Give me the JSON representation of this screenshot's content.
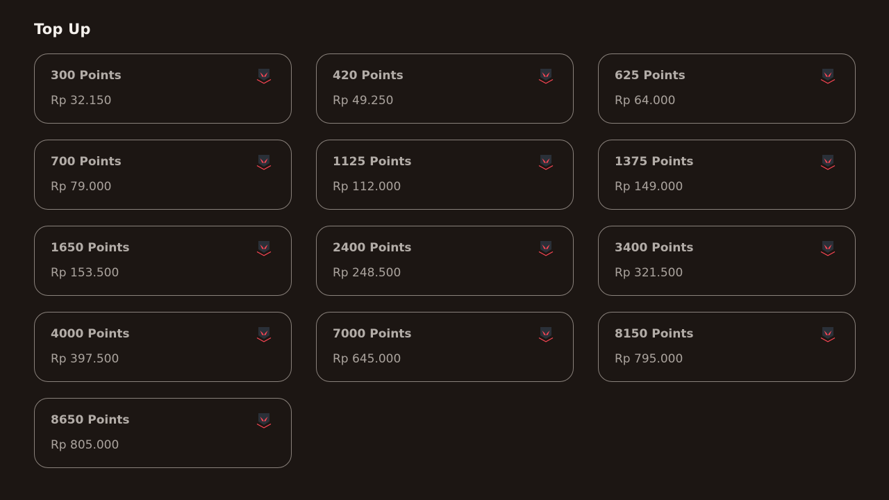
{
  "header": {
    "title": "Top Up"
  },
  "colors": {
    "background": "#1c1613",
    "card_border": "#8a827c",
    "accent": "#ff4655",
    "icon_shield": "#2a3038"
  },
  "card_icon": "valorant-points-icon",
  "packages": [
    {
      "points": "300 Points",
      "price": "Rp 32.150"
    },
    {
      "points": "420 Points",
      "price": "Rp 49.250"
    },
    {
      "points": "625 Points",
      "price": "Rp 64.000"
    },
    {
      "points": "700 Points",
      "price": "Rp 79.000"
    },
    {
      "points": "1125 Points",
      "price": "Rp 112.000"
    },
    {
      "points": "1375 Points",
      "price": "Rp 149.000"
    },
    {
      "points": "1650 Points",
      "price": "Rp 153.500"
    },
    {
      "points": "2400 Points",
      "price": "Rp 248.500"
    },
    {
      "points": "3400 Points",
      "price": "Rp 321.500"
    },
    {
      "points": "4000 Points",
      "price": "Rp 397.500"
    },
    {
      "points": "7000 Points",
      "price": "Rp 645.000"
    },
    {
      "points": "8150 Points",
      "price": "Rp 795.000"
    },
    {
      "points": "8650 Points",
      "price": "Rp 805.000"
    }
  ]
}
